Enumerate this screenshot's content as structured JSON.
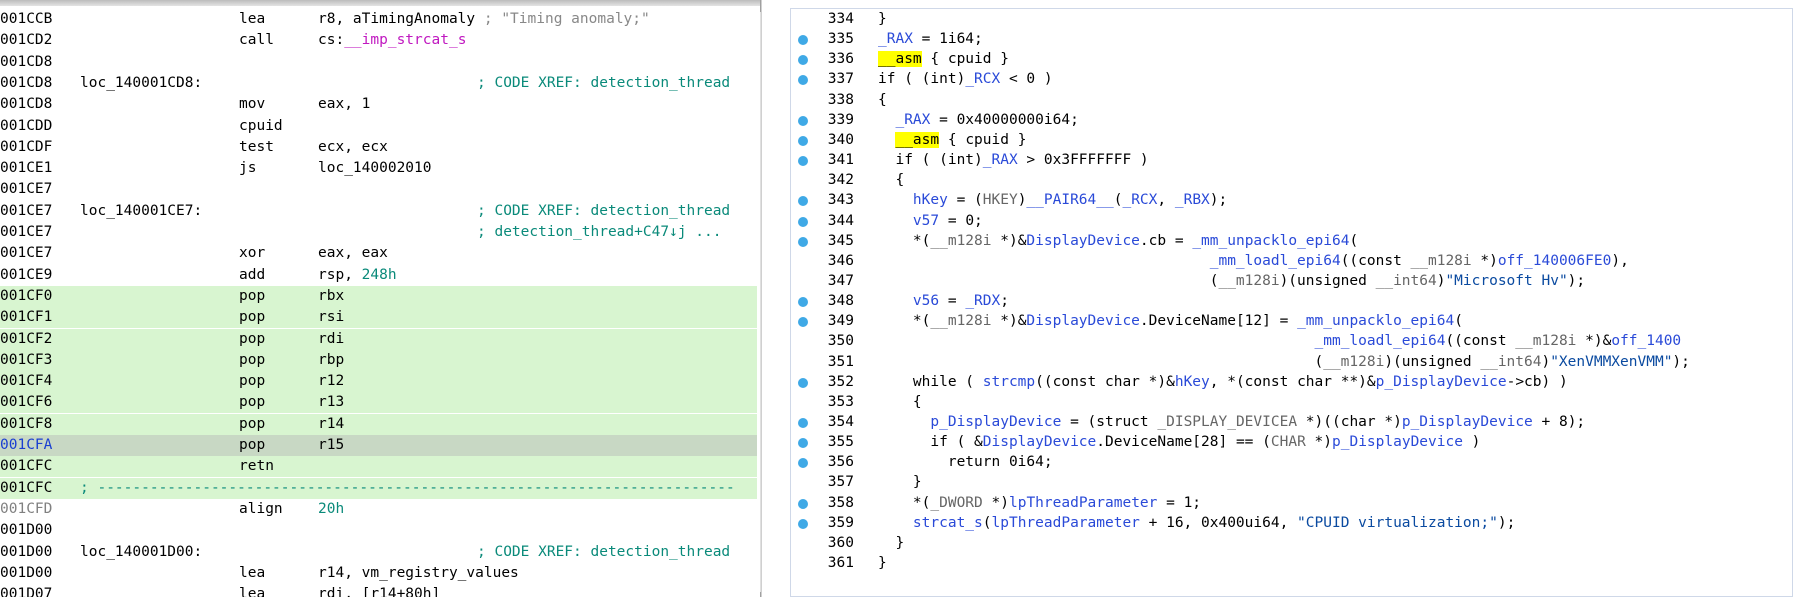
{
  "disasm": {
    "lines": [
      {
        "addr": "001CCB",
        "mnem": "lea",
        "ops": "r8, aTimingAnomaly",
        "cmt_grey": " ; \"Timing anomaly;\""
      },
      {
        "addr": "001CD2",
        "mnem": "call",
        "ops_prefix": "cs:",
        "ops_mag": "__imp_strcat_s"
      },
      {
        "addr": "001CD8"
      },
      {
        "addr": "001CD8",
        "label": "loc_140001CD8:",
        "cmt": "; CODE XREF: detection_thread"
      },
      {
        "addr": "001CD8",
        "mnem": "mov",
        "ops": "eax, 1"
      },
      {
        "addr": "001CDD",
        "mnem": "cpuid"
      },
      {
        "addr": "001CDF",
        "mnem": "test",
        "ops": "ecx, ecx"
      },
      {
        "addr": "001CE1",
        "mnem": "js",
        "ops": "loc_140002010"
      },
      {
        "addr": "001CE7"
      },
      {
        "addr": "001CE7",
        "label": "loc_140001CE7:",
        "cmt": "; CODE XREF: detection_thread"
      },
      {
        "addr": "001CE7",
        "cmt": "; detection_thread+C47↓j ..."
      },
      {
        "addr": "001CE7",
        "mnem": "xor",
        "ops": "eax, eax"
      },
      {
        "addr": "001CE9",
        "mnem": "add",
        "ops_prefix": "rsp, ",
        "ops_green": "248h"
      },
      {
        "addr": "001CF0",
        "mnem": "pop",
        "ops": "rbx",
        "bg": "green"
      },
      {
        "addr": "001CF1",
        "mnem": "pop",
        "ops": "rsi",
        "bg": "green"
      },
      {
        "addr": "001CF2",
        "mnem": "pop",
        "ops": "rdi",
        "bg": "green"
      },
      {
        "addr": "001CF3",
        "mnem": "pop",
        "ops": "rbp",
        "bg": "green"
      },
      {
        "addr": "001CF4",
        "mnem": "pop",
        "ops": "r12",
        "bg": "green"
      },
      {
        "addr": "001CF6",
        "mnem": "pop",
        "ops": "r13",
        "bg": "green"
      },
      {
        "addr": "001CF8",
        "mnem": "pop",
        "ops": "r14",
        "bg": "green"
      },
      {
        "addr": "001CFA",
        "mnem": "pop",
        "ops": "r15",
        "bg": "selected"
      },
      {
        "addr": "001CFC",
        "mnem": "retn",
        "bg": "green"
      },
      {
        "addr": "001CFC",
        "sep": "; -------------------------------------------------------------------------",
        "bg": "green"
      },
      {
        "addr": "001CFD",
        "mnem": "align",
        "ops_green": "20h",
        "addr_grey": true
      },
      {
        "addr": "001D00"
      },
      {
        "addr": "001D00",
        "label": "loc_140001D00:",
        "cmt": "; CODE XREF: detection_thread"
      },
      {
        "addr": "001D00",
        "mnem": "lea",
        "ops": "r14, vm_registry_values"
      },
      {
        "addr": "001D07",
        "mnem": "lea",
        "ops": "rdi, [r14+80h]"
      }
    ]
  },
  "pseudocode": {
    "lines": [
      {
        "n": "334",
        "dot": false,
        "code": "}"
      },
      {
        "n": "335",
        "dot": true,
        "code": "_RAX = 1i64;"
      },
      {
        "n": "336",
        "dot": true,
        "code": "__asm { cpuid }"
      },
      {
        "n": "337",
        "dot": true,
        "code": "if ( (int)_RCX < 0 )"
      },
      {
        "n": "338",
        "dot": false,
        "code": "{"
      },
      {
        "n": "339",
        "dot": true,
        "code": "  _RAX = 0x40000000i64;"
      },
      {
        "n": "340",
        "dot": true,
        "code": "  __asm { cpuid }"
      },
      {
        "n": "341",
        "dot": true,
        "code": "  if ( (int)_RAX > 0x3FFFFFFF )"
      },
      {
        "n": "342",
        "dot": false,
        "code": "  {"
      },
      {
        "n": "343",
        "dot": true,
        "code": "    hKey = (HKEY)__PAIR64__(_RCX, _RBX);"
      },
      {
        "n": "344",
        "dot": true,
        "code": "    v57 = 0;"
      },
      {
        "n": "345",
        "dot": true,
        "code": "    *(__m128i *)&DisplayDevice.cb = _mm_unpacklo_epi64("
      },
      {
        "n": "346",
        "dot": false,
        "code": "                                      _mm_loadl_epi64((const __m128i *)off_140006FE0),"
      },
      {
        "n": "347",
        "dot": false,
        "code": "                                      (__m128i)(unsigned __int64)\"Microsoft Hv\");"
      },
      {
        "n": "348",
        "dot": true,
        "code": "    v56 = _RDX;"
      },
      {
        "n": "349",
        "dot": true,
        "code": "    *(__m128i *)&DisplayDevice.DeviceName[12] = _mm_unpacklo_epi64("
      },
      {
        "n": "350",
        "dot": false,
        "code": "                                                  _mm_loadl_epi64((const __m128i *)&off_1400"
      },
      {
        "n": "351",
        "dot": false,
        "code": "                                                  (__m128i)(unsigned __int64)\"XenVMMXenVMM\");"
      },
      {
        "n": "352",
        "dot": true,
        "code": "    while ( strcmp((const char *)&hKey, *(const char **)&p_DisplayDevice->cb) )"
      },
      {
        "n": "353",
        "dot": false,
        "code": "    {"
      },
      {
        "n": "354",
        "dot": true,
        "code": "      p_DisplayDevice = (struct _DISPLAY_DEVICEA *)((char *)p_DisplayDevice + 8);"
      },
      {
        "n": "355",
        "dot": true,
        "code": "      if ( &DisplayDevice.DeviceName[28] == (CHAR *)p_DisplayDevice )"
      },
      {
        "n": "356",
        "dot": true,
        "code": "        return 0i64;"
      },
      {
        "n": "357",
        "dot": false,
        "code": "    }"
      },
      {
        "n": "358",
        "dot": true,
        "code": "    *(_DWORD *)lpThreadParameter = 1;"
      },
      {
        "n": "359",
        "dot": true,
        "code": "    strcat_s(lpThreadParameter + 16, 0x400ui64, \"CPUID virtualization;\");"
      },
      {
        "n": "360",
        "dot": false,
        "code": "  }"
      },
      {
        "n": "361",
        "dot": false,
        "code": "}"
      }
    ]
  },
  "colors": {
    "breakpoint_dot": "#3fa9e6",
    "executed_bg": "#d8f5d0",
    "selected_bg": "#c8d8c4",
    "comment": "#0a8a7a",
    "keyword_highlight": "#ffff00"
  }
}
